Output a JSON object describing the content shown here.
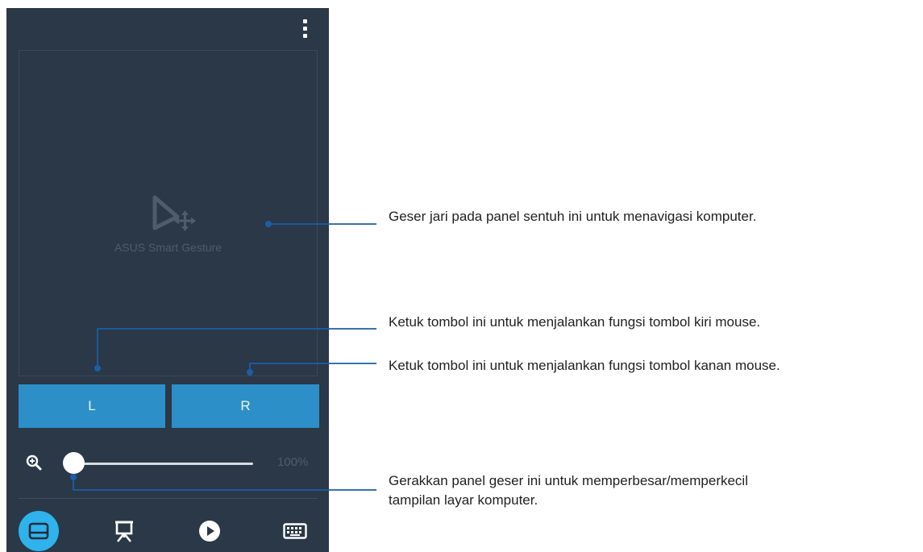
{
  "app": {
    "name": "ASUS Smart Gesture",
    "left_button": "L",
    "right_button": "R",
    "zoom_value": "100%",
    "zoom_fraction": 0.0,
    "nav_items": [
      "touchpad-icon",
      "presentation-icon",
      "play-icon",
      "keyboard-icon"
    ],
    "active_nav": "touchpad-icon"
  },
  "annotations": {
    "touchpad": "Geser jari pada panel sentuh ini untuk menavigasi komputer.",
    "left_button": "Ketuk tombol ini untuk menjalankan fungsi tombol kiri mouse.",
    "right_button": "Ketuk tombol ini untuk menjalankan fungsi tombol kanan mouse.",
    "slider_line1": "Gerakkan panel geser ini untuk memperbesar/memperkecil",
    "slider_line2": "tampilan layar komputer."
  },
  "colors": {
    "panel_bg": "#2b3847",
    "button_blue": "#2d8fc7",
    "active_nav": "#2fb3ec",
    "callout_line": "#1a5ea8"
  }
}
